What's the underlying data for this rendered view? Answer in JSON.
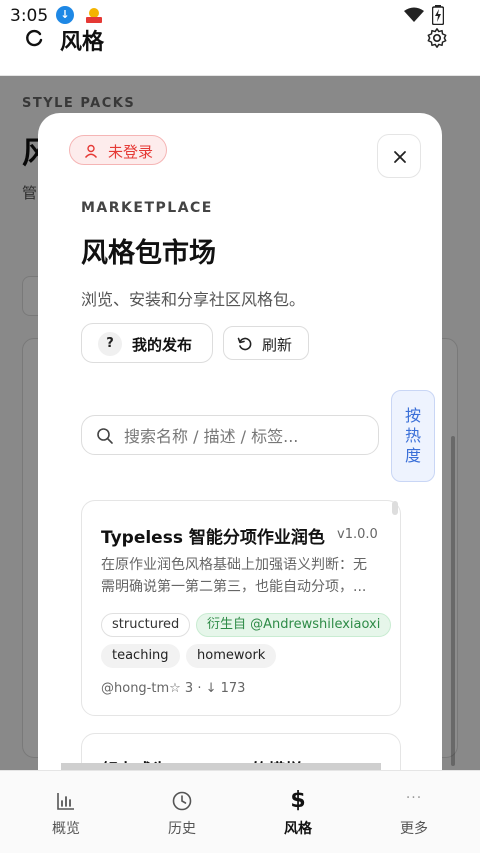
{
  "status_bar": {
    "time": "3:05",
    "download_glyph": "↓",
    "icons": [
      "download-icon",
      "app-notification-icon",
      "wifi-icon",
      "battery-charging-icon"
    ]
  },
  "app_bar": {
    "title": "风格",
    "icons": [
      "sync-icon",
      "gear-icon"
    ]
  },
  "background_page": {
    "eyebrow": "STYLE PACKS",
    "title": "风",
    "subtitle": "管"
  },
  "modal": {
    "login_badge": "未登录",
    "eyebrow": "MARKETPLACE",
    "title": "风格包市场",
    "subtitle": "浏览、安装和分享社区风格包。",
    "my_publish_label": "我的发布",
    "my_publish_icon_text": "?",
    "refresh_label": "刷新",
    "search_placeholder": "搜索名称 / 描述 / 标签...",
    "sort_chars": [
      "按",
      "热",
      "度"
    ],
    "cards": [
      {
        "title": "Typeless 智能分项作业润色",
        "version": "v1.0.0",
        "desc_lines": [
          "在原作业润色风格基础上加强语义判断：无",
          "需明确说第一第二第三，也能自动分项，..."
        ],
        "tags": [
          "structured",
          "teaching",
          "homework"
        ],
        "derived_from": "衍生自 @Andrewshilexiaoxi",
        "author": "@hong-tm",
        "stars": "☆ 3",
        "downloads": "↓ 173"
      },
      {
        "title": "努力成为Typeless的模样"
      }
    ]
  },
  "bottom_nav": [
    {
      "label": "概览",
      "icon": "bar-chart-icon",
      "active": false
    },
    {
      "label": "历史",
      "icon": "clock-icon",
      "active": false
    },
    {
      "label": "风格",
      "icon": "dollar-icon",
      "active": true,
      "glyph": "$"
    },
    {
      "label": "更多",
      "icon": "more-icon",
      "active": false,
      "glyph": "···"
    }
  ],
  "colors": {
    "accent_red": "#e53935",
    "accent_green": "#2e8b47",
    "accent_blue": "#3a6fd8"
  }
}
